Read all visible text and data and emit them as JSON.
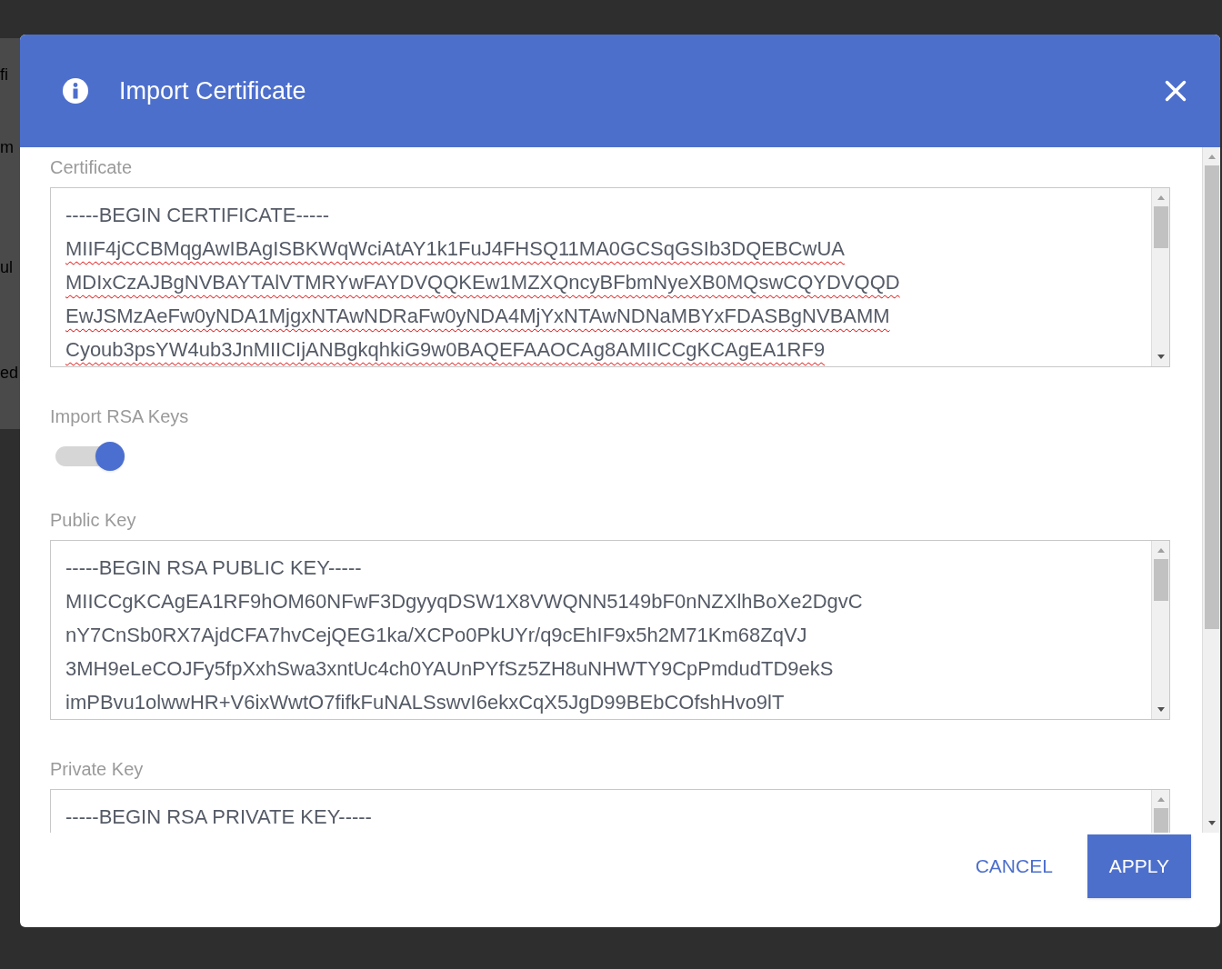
{
  "background": {
    "fragments": [
      "fi",
      "m",
      "ul",
      "ed"
    ]
  },
  "dialog": {
    "title": "Import Certificate",
    "fields": [
      {
        "kind": "textarea",
        "label": "Certificate",
        "lines": [
          {
            "text": "-----BEGIN CERTIFICATE-----",
            "flagged": false
          },
          {
            "text": "MIIF4jCCBMqgAwIBAgISBKWqWciAtAY1k1FuJ4FHSQ11MA0GCSqGSIb3DQEBCwUA",
            "flagged": true
          },
          {
            "text": "MDIxCzAJBgNVBAYTAlVTMRYwFAYDVQQKEw1MZXQncyBFbmNyeXB0MQswCQYDVQQD",
            "flagged": true
          },
          {
            "text": "EwJSMzAeFw0yNDA1MjgxNTAwNDRaFw0yNDA4MjYxNTAwNDNaMBYxFDASBgNVBAMM",
            "flagged": true
          },
          {
            "text": "Cyoub3psYW4ub3JnMIICIjANBgkqhkiG9w0BAQEFAAOCAg8AMIICCgKCAgEA1RF9",
            "flagged": true
          }
        ]
      },
      {
        "kind": "toggle",
        "label": "Import RSA Keys",
        "on": true
      },
      {
        "kind": "textarea",
        "label": "Public Key",
        "lines": [
          {
            "text": "-----BEGIN RSA PUBLIC KEY-----",
            "flagged": false
          },
          {
            "text": "MIICCgKCAgEA1RF9hOM60NFwF3DgyyqDSW1X8VWQNN5149bF0nNZXlhBoXe2DgvC",
            "flagged": false
          },
          {
            "text": "nY7CnSb0RX7AjdCFA7hvCejQEG1ka/XCPo0PkUYr/q9cEhIF9x5h2M71Km68ZqVJ",
            "flagged": false
          },
          {
            "text": "3MH9eLeCOJFy5fpXxhSwa3xntUc4ch0YAUnPYfSz5ZH8uNHWTY9CpPmdudTD9ekS",
            "flagged": false
          },
          {
            "text": "imPBvu1olwwHR+V6ixWwtO7fifkFuNALSswvI6ekxCqX5JgD99BEbCOfshHvo9lT",
            "flagged": false
          }
        ]
      },
      {
        "kind": "textarea",
        "label": "Private Key",
        "lines": [
          {
            "text": "-----BEGIN RSA PRIVATE KEY-----",
            "flagged": false
          }
        ]
      }
    ],
    "buttons": [
      {
        "label": "CANCEL",
        "kind": "text"
      },
      {
        "label": "APPLY",
        "kind": "primary"
      }
    ]
  }
}
